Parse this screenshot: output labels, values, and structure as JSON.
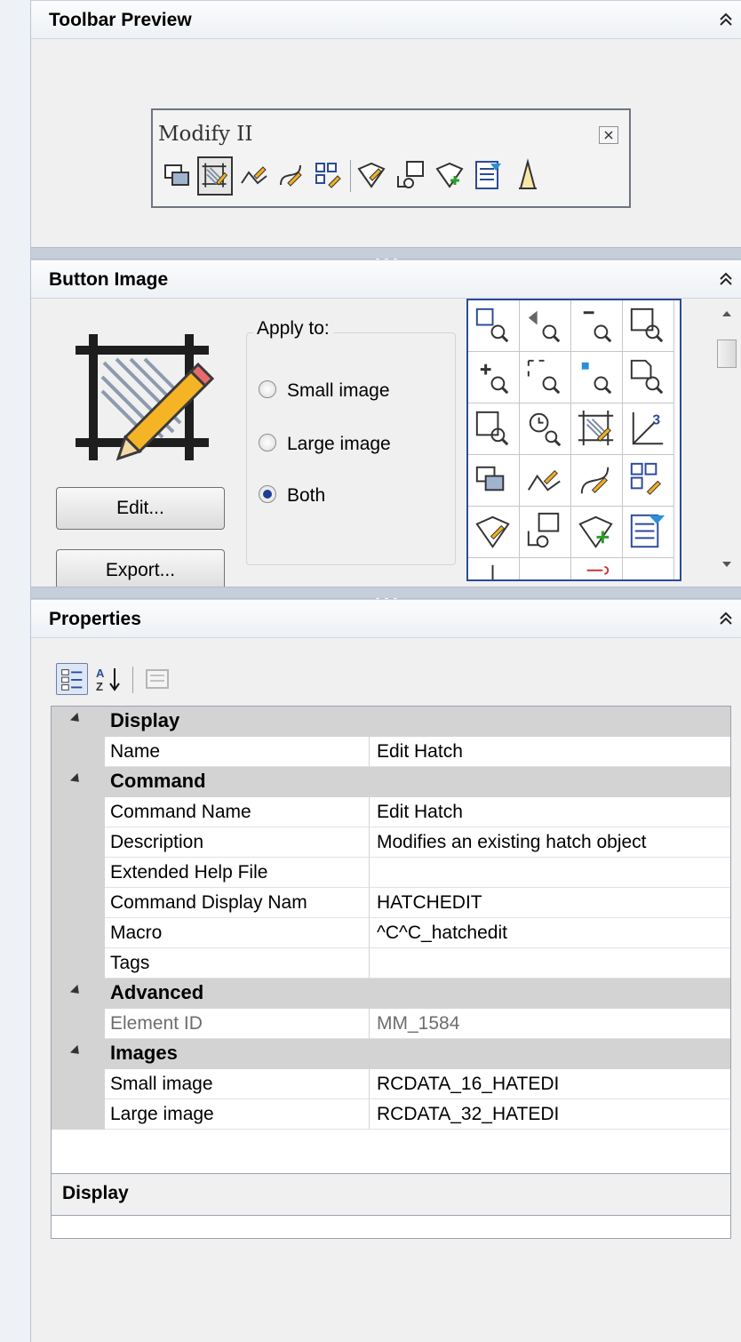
{
  "toolbar_preview": {
    "title": "Toolbar Preview",
    "toolbar_name": "Modify II",
    "icons": [
      "draw-order-icon",
      "edit-hatch-icon",
      "edit-polyline-icon",
      "edit-spline-icon",
      "edit-array-icon",
      "edit-attribute-icon",
      "block-editor-icon",
      "attribute-manager-icon",
      "sync-attributes-icon",
      "attribute-extract-icon"
    ]
  },
  "button_image": {
    "title": "Button Image",
    "edit_label": "Edit...",
    "export_label": "Export...",
    "apply_to_label": "Apply to:",
    "options": [
      {
        "label": "Small image",
        "selected": false
      },
      {
        "label": "Large image",
        "selected": false
      },
      {
        "label": "Both",
        "selected": true
      }
    ]
  },
  "properties": {
    "title": "Properties",
    "categories": [
      {
        "name": "Display",
        "rows": [
          {
            "key": "Name",
            "value": "Edit Hatch"
          }
        ]
      },
      {
        "name": "Command",
        "rows": [
          {
            "key": "Command Name",
            "value": "Edit Hatch"
          },
          {
            "key": "Description",
            "value": "Modifies an existing hatch object"
          },
          {
            "key": "Extended Help File",
            "value": ""
          },
          {
            "key": "Command Display Nam",
            "value": "HATCHEDIT"
          },
          {
            "key": "Macro",
            "value": "^C^C_hatchedit"
          },
          {
            "key": "Tags",
            "value": ""
          }
        ]
      },
      {
        "name": "Advanced",
        "rows": [
          {
            "key": "Element ID",
            "value": "MM_1584"
          }
        ]
      },
      {
        "name": "Images",
        "rows": [
          {
            "key": "Small image",
            "value": "RCDATA_16_HATEDI"
          },
          {
            "key": "Large image",
            "value": "RCDATA_32_HATEDI"
          }
        ]
      }
    ],
    "description_title": "Display"
  }
}
